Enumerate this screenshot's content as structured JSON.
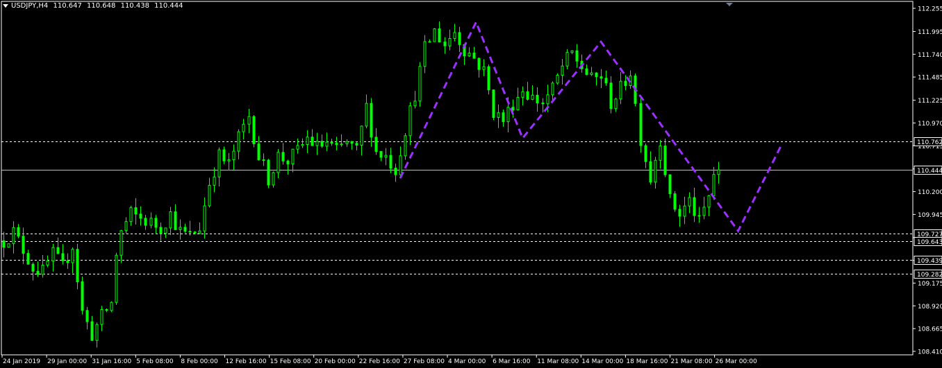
{
  "header": {
    "symbol": "USDJPY,H4",
    "open": "110.647",
    "high": "110.648",
    "low": "110.438",
    "close": "110.444"
  },
  "colors": {
    "background": "#000000",
    "candle": "#00ff00",
    "pattern": "#9b30ff",
    "grid": "#ffffff",
    "text": "#ffffff"
  },
  "chart_data": {
    "type": "candlestick",
    "symbol": "USDJPY",
    "timeframe": "H4",
    "ylim": [
      108.43,
      112.3
    ],
    "y_ticks": [
      "112.255",
      "111.995",
      "111.740",
      "111.485",
      "111.225",
      "110.970",
      "110.715",
      "110.455",
      "110.200",
      "109.945",
      "109.685",
      "109.430",
      "109.175",
      "108.920",
      "108.665",
      "108.410"
    ],
    "x_ticks": [
      "24 Jan 2019",
      "29 Jan 00:00",
      "31 Jan 16:00",
      "5 Feb 08:00",
      "8 Feb 00:00",
      "12 Feb 16:00",
      "15 Feb 08:00",
      "20 Feb 00:00",
      "22 Feb 16:00",
      "27 Feb 08:00",
      "4 Mar 00:00",
      "6 Mar 16:00",
      "11 Mar 08:00",
      "14 Mar 00:00",
      "18 Mar 16:00",
      "21 Mar 08:00",
      "26 Mar 00:00"
    ],
    "horizontal_levels": [
      {
        "value": 110.762,
        "label": "110.762",
        "style": "dashed"
      },
      {
        "value": 110.444,
        "label": "110.444",
        "style": "solid",
        "current_price": true
      },
      {
        "value": 109.727,
        "label": "109.727",
        "style": "dashed"
      },
      {
        "value": 109.643,
        "label": "109.643",
        "style": "dashed"
      },
      {
        "value": 109.439,
        "label": "109.439",
        "style": "dashed"
      },
      {
        "value": 109.282,
        "label": "109.282",
        "style": "dashed"
      }
    ],
    "price_path": [
      {
        "t": 0,
        "p": 109.65
      },
      {
        "t": 2,
        "p": 109.75
      },
      {
        "t": 4,
        "p": 109.55
      },
      {
        "t": 6,
        "p": 109.35
      },
      {
        "t": 8,
        "p": 109.3
      },
      {
        "t": 10,
        "p": 109.5
      },
      {
        "t": 12,
        "p": 109.35
      },
      {
        "t": 14,
        "p": 109.6
      },
      {
        "t": 16,
        "p": 108.85
      },
      {
        "t": 18,
        "p": 108.6
      },
      {
        "t": 20,
        "p": 108.8
      },
      {
        "t": 22,
        "p": 108.95
      },
      {
        "t": 23,
        "p": 109.5
      },
      {
        "t": 24,
        "p": 109.75
      },
      {
        "t": 26,
        "p": 109.95
      },
      {
        "t": 28,
        "p": 109.9
      },
      {
        "t": 30,
        "p": 109.85
      },
      {
        "t": 32,
        "p": 109.8
      },
      {
        "t": 34,
        "p": 109.95
      },
      {
        "t": 36,
        "p": 109.75
      },
      {
        "t": 38,
        "p": 109.7
      },
      {
        "t": 40,
        "p": 109.8
      },
      {
        "t": 42,
        "p": 110.3
      },
      {
        "t": 44,
        "p": 110.6
      },
      {
        "t": 46,
        "p": 110.5
      },
      {
        "t": 48,
        "p": 110.8
      },
      {
        "t": 50,
        "p": 111.05
      },
      {
        "t": 52,
        "p": 110.6
      },
      {
        "t": 54,
        "p": 110.35
      },
      {
        "t": 56,
        "p": 110.6
      },
      {
        "t": 58,
        "p": 110.55
      },
      {
        "t": 60,
        "p": 110.65
      },
      {
        "t": 62,
        "p": 110.8
      },
      {
        "t": 64,
        "p": 110.7
      },
      {
        "t": 66,
        "p": 110.75
      },
      {
        "t": 68,
        "p": 110.65
      },
      {
        "t": 70,
        "p": 110.75
      },
      {
        "t": 72,
        "p": 110.65
      },
      {
        "t": 74,
        "p": 111.15
      },
      {
        "t": 76,
        "p": 110.65
      },
      {
        "t": 78,
        "p": 110.6
      },
      {
        "t": 80,
        "p": 110.45
      },
      {
        "t": 82,
        "p": 110.9
      },
      {
        "t": 84,
        "p": 111.3
      },
      {
        "t": 86,
        "p": 111.8
      },
      {
        "t": 88,
        "p": 112.0
      },
      {
        "t": 90,
        "p": 111.85
      },
      {
        "t": 92,
        "p": 112.0
      },
      {
        "t": 94,
        "p": 111.8
      },
      {
        "t": 96,
        "p": 111.7
      },
      {
        "t": 98,
        "p": 111.55
      },
      {
        "t": 100,
        "p": 111.1
      },
      {
        "t": 102,
        "p": 111.0
      },
      {
        "t": 104,
        "p": 111.2
      },
      {
        "t": 106,
        "p": 111.35
      },
      {
        "t": 108,
        "p": 111.25
      },
      {
        "t": 110,
        "p": 111.2
      },
      {
        "t": 112,
        "p": 111.35
      },
      {
        "t": 114,
        "p": 111.6
      },
      {
        "t": 116,
        "p": 111.75
      },
      {
        "t": 118,
        "p": 111.6
      },
      {
        "t": 120,
        "p": 111.45
      },
      {
        "t": 122,
        "p": 111.5
      },
      {
        "t": 124,
        "p": 111.2
      },
      {
        "t": 126,
        "p": 111.35
      },
      {
        "t": 128,
        "p": 111.55
      },
      {
        "t": 130,
        "p": 110.8
      },
      {
        "t": 132,
        "p": 110.35
      },
      {
        "t": 134,
        "p": 110.8
      },
      {
        "t": 136,
        "p": 110.1
      },
      {
        "t": 138,
        "p": 109.95
      },
      {
        "t": 140,
        "p": 110.1
      },
      {
        "t": 142,
        "p": 109.85
      },
      {
        "t": 144,
        "p": 110.15
      },
      {
        "t": 146,
        "p": 110.65
      }
    ],
    "pattern_line": [
      {
        "t": 81,
        "p": 110.35
      },
      {
        "t": 96.5,
        "p": 112.1
      },
      {
        "t": 106,
        "p": 110.8
      },
      {
        "t": 122,
        "p": 111.88
      },
      {
        "t": 150,
        "p": 109.76
      },
      {
        "t": 159,
        "p": 110.74
      }
    ]
  }
}
